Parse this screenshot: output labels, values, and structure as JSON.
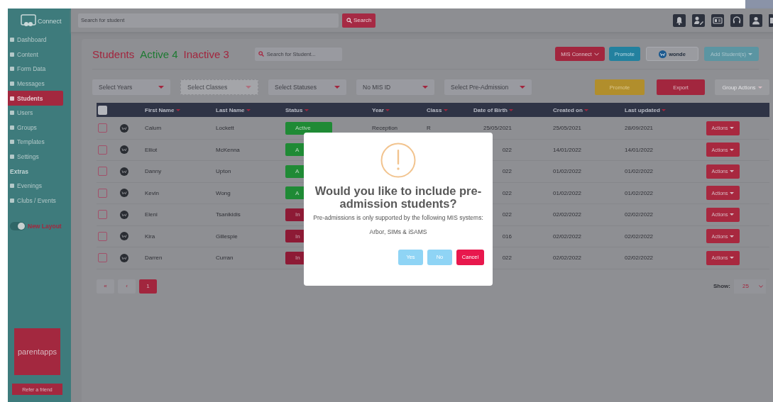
{
  "sidebar": {
    "logo": "Connect",
    "items": [
      {
        "label": "Dashboard",
        "selected": false
      },
      {
        "label": "Content",
        "selected": false
      },
      {
        "label": "Form Data",
        "selected": false
      },
      {
        "label": "Messages",
        "selected": false
      },
      {
        "label": "Students",
        "selected": true
      },
      {
        "label": "Users",
        "selected": false
      },
      {
        "label": "Groups",
        "selected": false
      },
      {
        "label": "Templates",
        "selected": false
      },
      {
        "label": "Settings",
        "selected": false
      }
    ],
    "section": "Extras",
    "extras": [
      {
        "label": "Evenings",
        "selected": false
      },
      {
        "label": "Clubs / Events",
        "selected": false
      }
    ],
    "toggle": {
      "label": "New Layout",
      "on": true
    },
    "brand": "parentapps",
    "refer": "Refer a friend"
  },
  "topbar": {
    "search": {
      "placeholder": "Search for student"
    },
    "button": "Search"
  },
  "header": {
    "title": "Students",
    "active": "Active 4",
    "inactive": "Inactive 3",
    "search": {
      "placeholder": "Search for Student..."
    },
    "buttons": [
      {
        "label": "MIS Connect",
        "kind": "mis"
      },
      {
        "label": "Promote",
        "kind": "promote"
      },
      {
        "label": "wonde",
        "kind": "wonde"
      },
      {
        "label": "Add Student(s)",
        "kind": "add"
      }
    ]
  },
  "filters": [
    {
      "placeholder": "Select Years",
      "disabled": false
    },
    {
      "placeholder": "Select Classes",
      "disabled": true
    },
    {
      "placeholder": "Select Statuses",
      "disabled": false
    },
    {
      "placeholder": "No MIS ID",
      "disabled": false
    },
    {
      "placeholder": "Select Pre-Admission",
      "disabled": false
    }
  ],
  "actions": [
    {
      "label": "Promote",
      "kind": "promote"
    },
    {
      "label": "Export",
      "kind": "export"
    },
    {
      "label": "Group Actions",
      "kind": "group"
    }
  ],
  "table": {
    "select_all_checked": false,
    "columns": [
      "First Name",
      "Last Name",
      "Status",
      "Year",
      "Class",
      "Date of Birth",
      "Created on",
      "Last updated"
    ],
    "rows": [
      {
        "checked": false,
        "first": "Calum",
        "last": "Lockett",
        "status": {
          "label": "Active",
          "kind": "active"
        },
        "year": "Reception",
        "class": "R",
        "dob": "25/05/2021",
        "created": "25/05/2021",
        "updated": "28/09/2021",
        "action": "Actions"
      },
      {
        "checked": false,
        "first": "Elliot",
        "last": "McKenna",
        "status": {
          "label": "A",
          "kind": "active"
        },
        "dob": "022",
        "created": "14/01/2022",
        "updated": "14/01/2022",
        "action": "Actions"
      },
      {
        "checked": false,
        "first": "Danny",
        "last": "Upton",
        "status": {
          "label": "A",
          "kind": "active"
        },
        "dob": "022",
        "created": "01/02/2022",
        "updated": "01/02/2022",
        "action": "Actions"
      },
      {
        "checked": false,
        "first": "Kevin",
        "last": "Wong",
        "status": {
          "label": "A",
          "kind": "active"
        },
        "dob": "022",
        "created": "01/02/2022",
        "updated": "01/02/2022",
        "action": "Actions"
      },
      {
        "checked": false,
        "first": "Eleni",
        "last": "Tsanikidis",
        "status": {
          "label": "In",
          "kind": "inactive"
        },
        "dob": "022",
        "created": "02/02/2022",
        "updated": "02/02/2022",
        "action": "Actions"
      },
      {
        "checked": false,
        "first": "Kira",
        "last": "Gillespie",
        "status": {
          "label": "In",
          "kind": "inactive"
        },
        "dob": "016",
        "created": "02/02/2022",
        "updated": "02/02/2022",
        "action": "Actions"
      },
      {
        "checked": false,
        "first": "Darren",
        "last": "Curran",
        "status": {
          "label": "In",
          "kind": "inactive"
        },
        "dob": "022",
        "created": "02/02/2022",
        "updated": "02/02/2022",
        "action": "Actions"
      }
    ]
  },
  "pagination": {
    "pages": [
      {
        "label": "«",
        "selected": false
      },
      {
        "label": "‹",
        "selected": false
      },
      {
        "label": "1",
        "selected": true
      }
    ],
    "show_label": "Show:",
    "show_value": "25"
  },
  "modal": {
    "title": "Would you like to include pre-admission students?",
    "text": "Pre-admissions is only supported by the following MIS systems:",
    "systems": "Arbor, SIMs & iSAMS",
    "buttons": [
      {
        "label": "Yes",
        "kind": "confirm"
      },
      {
        "label": "No",
        "kind": "deny"
      },
      {
        "label": "Cancel",
        "kind": "cancel"
      }
    ]
  }
}
